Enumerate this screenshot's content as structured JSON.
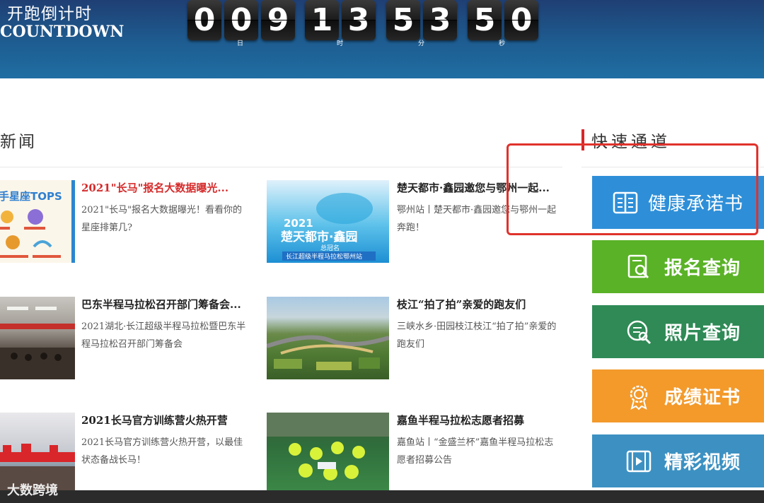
{
  "header": {
    "brand_cn": "开跑倒计时",
    "brand_en": "COUNTDOWN",
    "digits": [
      "0",
      "0",
      "9",
      "1",
      "3",
      "5",
      "3",
      "5",
      "0"
    ],
    "units": [
      "日",
      "时",
      "分",
      "秒"
    ]
  },
  "news": {
    "title": "新闻",
    "items": [
      {
        "title": "2021\"长马\"报名大数据曝光...",
        "desc": "2021\"长马\"报名大数据曝光！看看你的星座排第几?",
        "thumb_text": "手星座TOPS"
      },
      {
        "title": "楚天都市·鑫园邀您与鄂州一起...",
        "desc": "鄂州站丨楚天都市·鑫园邀您与鄂州一起奔跑！",
        "thumb_year": "2021",
        "thumb_text": "楚天都市·鑫园",
        "thumb_sub": "总冠名",
        "thumb_band": "长江超级半程马拉松鄂州站"
      },
      {
        "title": "巴东半程马拉松召开部门筹备会...",
        "desc": "2021湖北·长江超级半程马拉松暨巴东半程马拉松召开部门筹备会"
      },
      {
        "title": "枝江“拍了拍”亲爱的跑友们",
        "desc": "三峡水乡·田园枝江枝江“拍了拍”亲爱的跑友们"
      },
      {
        "title": "2021长马官方训练营火热开营",
        "desc": "2021长马官方训练营火热开营，以最佳状态备战长马！"
      },
      {
        "title": "嘉鱼半程马拉松志愿者招募",
        "desc": "嘉鱼站丨“金盛兰杯”嘉鱼半程马拉松志愿者招募公告"
      }
    ]
  },
  "quick": {
    "title": "快速通道",
    "buttons": [
      {
        "label": "健康承诺书",
        "color": "#2e8fd8",
        "icon": "book-icon"
      },
      {
        "label": "报名查询",
        "color": "#5ab227",
        "icon": "document-search-icon"
      },
      {
        "label": "照片查询",
        "color": "#2f8a56",
        "icon": "search-list-icon"
      },
      {
        "label": "成绩证书",
        "color": "#f39a2b",
        "icon": "medal-icon"
      },
      {
        "label": "精彩视频",
        "color": "#3c91c2",
        "icon": "film-icon"
      }
    ]
  },
  "watermark": "大数跨境"
}
